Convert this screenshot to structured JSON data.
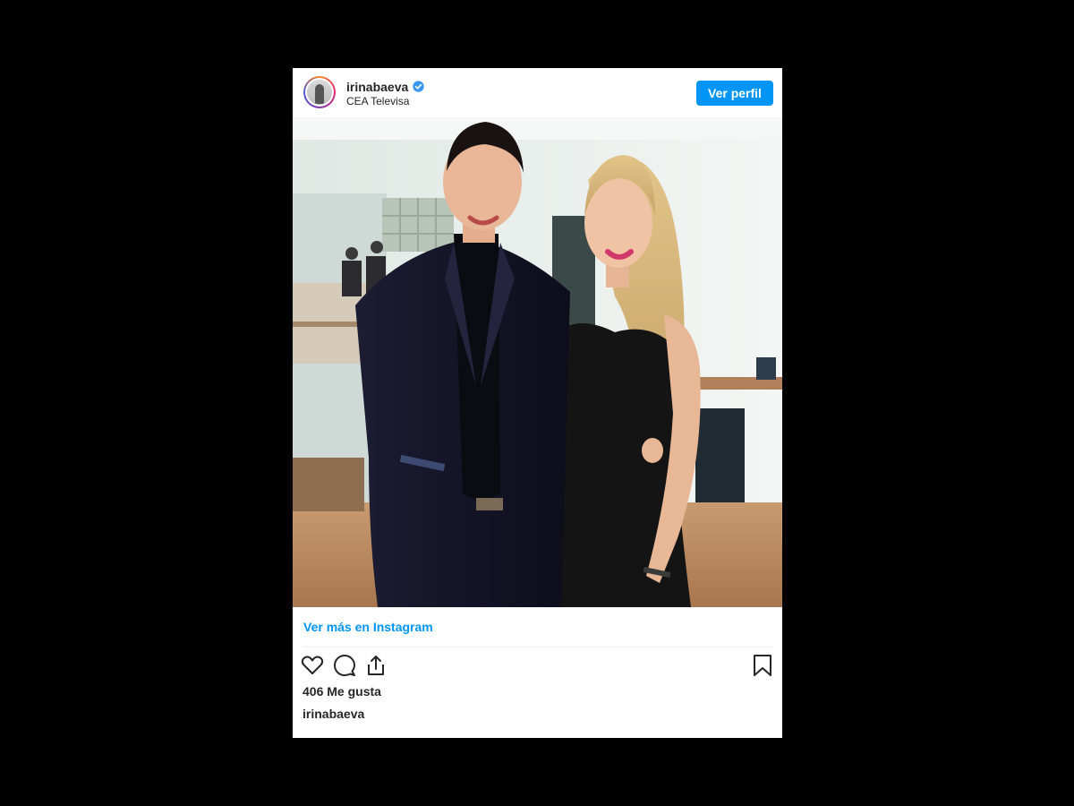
{
  "post": {
    "username": "irinabaeva",
    "location": "CEA Televisa",
    "view_profile_label": "Ver perfil",
    "view_more_label": "Ver más en Instagram",
    "likes_text": "406 Me gusta",
    "caption_username": "irinabaeva"
  },
  "icons": {
    "verified": "verified-badge-icon",
    "like": "heart-icon",
    "comment": "comment-icon",
    "share": "share-icon",
    "save": "bookmark-icon"
  },
  "colors": {
    "accent": "#0095f6",
    "text": "#262626",
    "backdrop": "#000000"
  }
}
